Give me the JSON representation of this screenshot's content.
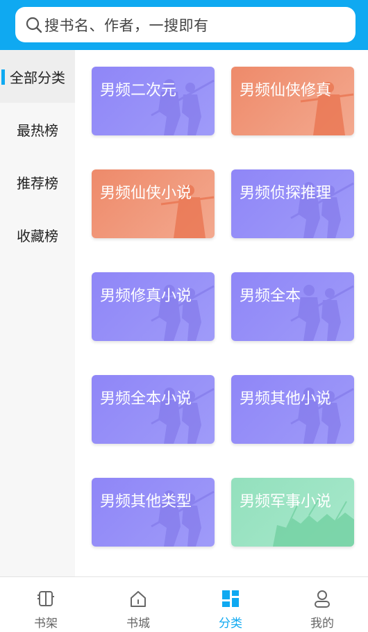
{
  "search": {
    "placeholder": "搜书名、作者，一搜即有"
  },
  "sidebar": {
    "items": [
      {
        "label": "全部分类",
        "active": true
      },
      {
        "label": "最热榜",
        "active": false
      },
      {
        "label": "推荐榜",
        "active": false
      },
      {
        "label": "收藏榜",
        "active": false
      }
    ]
  },
  "categories": [
    {
      "label": "男频二次元",
      "theme": "purple"
    },
    {
      "label": "男频仙侠修真",
      "theme": "orange"
    },
    {
      "label": "男频仙侠小说",
      "theme": "orange"
    },
    {
      "label": "男频侦探推理",
      "theme": "purple"
    },
    {
      "label": "男频修真小说",
      "theme": "purple"
    },
    {
      "label": "男频全本",
      "theme": "purple"
    },
    {
      "label": "男频全本小说",
      "theme": "purple"
    },
    {
      "label": "男频其他小说",
      "theme": "purple"
    },
    {
      "label": "男频其他类型",
      "theme": "purple"
    },
    {
      "label": "男频军事小说",
      "theme": "green"
    }
  ],
  "tabbar": {
    "items": [
      {
        "label": "书架",
        "icon": "bookshelf-icon",
        "active": false
      },
      {
        "label": "书城",
        "icon": "home-icon",
        "active": false
      },
      {
        "label": "分类",
        "icon": "category-grid-icon",
        "active": true
      },
      {
        "label": "我的",
        "icon": "user-icon",
        "active": false
      }
    ]
  },
  "colors": {
    "accent": "#0fa9f1",
    "card_purple": "#8f86f7",
    "card_orange": "#ee8a6a",
    "card_green": "#93e0bd"
  }
}
